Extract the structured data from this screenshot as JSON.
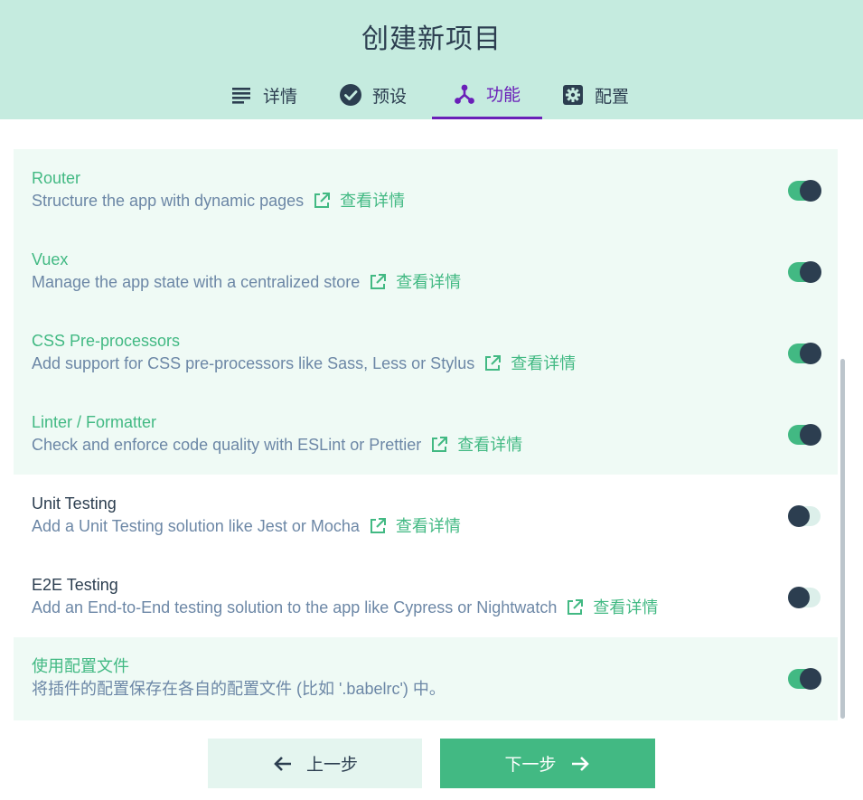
{
  "header": {
    "title": "创建新项目",
    "tabs": [
      {
        "label": "详情",
        "icon": "list-icon"
      },
      {
        "label": "预设",
        "icon": "check-circle-icon"
      },
      {
        "label": "功能",
        "icon": "graph-icon",
        "active": true
      },
      {
        "label": "配置",
        "icon": "gear-icon"
      }
    ]
  },
  "features": [
    {
      "title": "Router",
      "desc": "Structure the app with dynamic pages",
      "link": "查看详情",
      "enabled": true
    },
    {
      "title": "Vuex",
      "desc": "Manage the app state with a centralized store",
      "link": "查看详情",
      "enabled": true
    },
    {
      "title": "CSS Pre-processors",
      "desc": "Add support for CSS pre-processors like Sass, Less or Stylus",
      "link": "查看详情",
      "enabled": true
    },
    {
      "title": "Linter / Formatter",
      "desc": "Check and enforce code quality with ESLint or Prettier",
      "link": "查看详情",
      "enabled": true
    },
    {
      "title": "Unit Testing",
      "desc": "Add a Unit Testing solution like Jest or Mocha",
      "link": "查看详情",
      "enabled": false
    },
    {
      "title": "E2E Testing",
      "desc": "Add an End-to-End testing solution to the app like Cypress or Nightwatch",
      "link": "查看详情",
      "enabled": false
    },
    {
      "title": "使用配置文件",
      "desc": "将插件的配置保存在各自的配置文件 (比如 '.babelrc') 中。",
      "enabled": true
    }
  ],
  "footer": {
    "prev_label": "上一步",
    "next_label": "下一步"
  },
  "colors": {
    "header_bg": "#c5ebdf",
    "accent": "#42b983",
    "active_tab": "#6a1fb8",
    "text": "#2c3e50",
    "desc": "#6c87a6"
  }
}
